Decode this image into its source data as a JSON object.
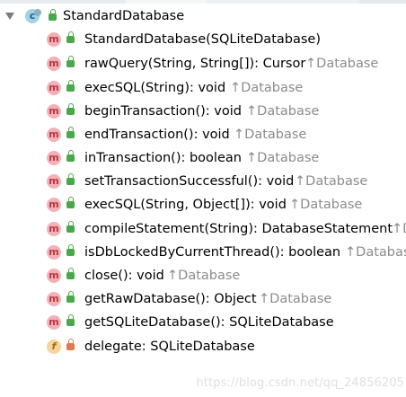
{
  "tree": {
    "root": {
      "label": "StandardDatabase",
      "icon": "class-icon",
      "expanded": true
    },
    "items": [
      {
        "kind": "method",
        "signature": "StandardDatabase(SQLiteDatabase)",
        "origin": ""
      },
      {
        "kind": "method",
        "signature": "rawQuery(String, String[]): Cursor",
        "origin": "↑Database"
      },
      {
        "kind": "method",
        "signature": "execSQL(String): void",
        "origin": "↑Database"
      },
      {
        "kind": "method",
        "signature": "beginTransaction(): void",
        "origin": "↑Database"
      },
      {
        "kind": "method",
        "signature": "endTransaction(): void",
        "origin": "↑Database"
      },
      {
        "kind": "method",
        "signature": "inTransaction(): boolean",
        "origin": "↑Database"
      },
      {
        "kind": "method",
        "signature": "setTransactionSuccessful(): void",
        "origin": "↑Database"
      },
      {
        "kind": "method",
        "signature": "execSQL(String, Object[]): void",
        "origin": "↑Database"
      },
      {
        "kind": "method",
        "signature": "compileStatement(String): DatabaseStatement",
        "origin": "↑D"
      },
      {
        "kind": "method",
        "signature": "isDbLockedByCurrentThread(): boolean",
        "origin": "↑Databas"
      },
      {
        "kind": "method",
        "signature": "close(): void",
        "origin": "↑Database"
      },
      {
        "kind": "method",
        "signature": "getRawDatabase(): Object",
        "origin": "↑Database"
      },
      {
        "kind": "method",
        "signature": "getSQLiteDatabase(): SQLiteDatabase",
        "origin": ""
      },
      {
        "kind": "field",
        "signature": "delegate: SQLiteDatabase",
        "origin": ""
      }
    ]
  },
  "watermark": "https://blog.csdn.net/qq_24856205",
  "colors": {
    "method_badge": "#f4b0b6",
    "class_badge": "#9fd3ea",
    "field_badge": "#f7d59a",
    "public_lock": "#49a849",
    "private_lock": "#e27a4f",
    "hint_text": "#8c8c8c"
  }
}
